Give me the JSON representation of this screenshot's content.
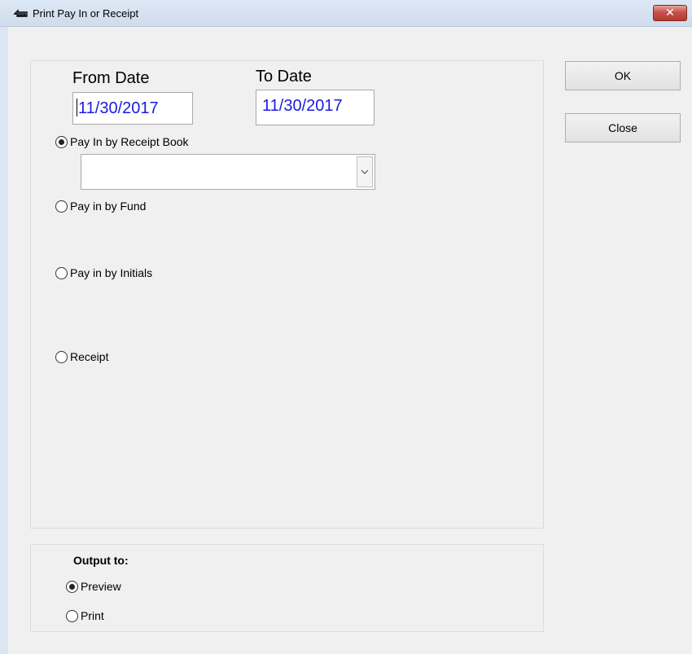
{
  "window": {
    "title": "Print Pay In or Receipt",
    "close_label": "✕"
  },
  "dates": {
    "from_label": "From Date",
    "from_value": "11/30/2017",
    "to_label": "To Date",
    "to_value": "11/30/2017"
  },
  "options": [
    {
      "label": "Pay In by Receipt Book",
      "checked": true
    },
    {
      "label": "Pay in by Fund",
      "checked": false
    },
    {
      "label": "Pay in by Initials",
      "checked": false
    },
    {
      "label": "Receipt",
      "checked": false
    }
  ],
  "receipt_book_combo": {
    "value": ""
  },
  "buttons": {
    "ok_label": "OK",
    "close_label": "Close"
  },
  "output": {
    "label": "Output to:",
    "options": [
      {
        "label": "Preview",
        "checked": true
      },
      {
        "label": "Print",
        "checked": false
      }
    ]
  },
  "icons": {
    "title_icon": "printer-tray-icon",
    "combo_icon": "chevron-down-icon"
  }
}
